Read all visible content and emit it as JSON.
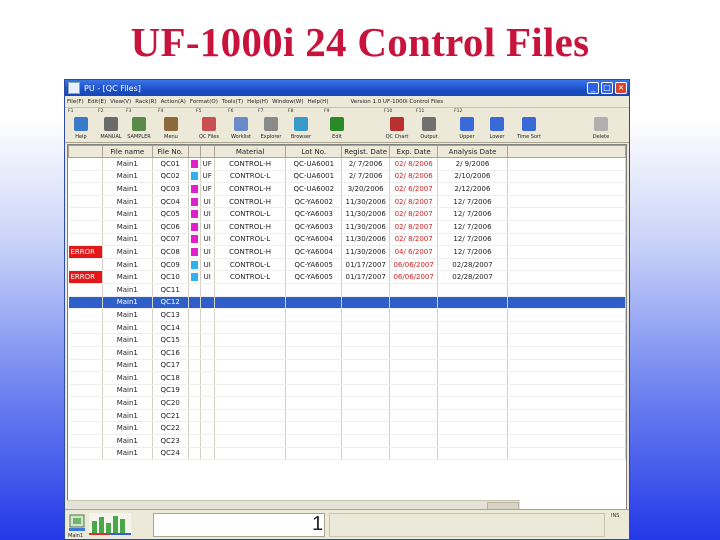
{
  "slide": {
    "title": "UF-1000i 24 Control Files",
    "page_number": "1"
  },
  "window": {
    "title": "PU - [QC Files]"
  },
  "menu": {
    "items": [
      "File(F)",
      "Edit(E)",
      "View(V)",
      "Rack(R)",
      "Action(A)",
      "Format(O)",
      "Tools(T)",
      "Help(H)",
      "Window(W)",
      "Help(H)"
    ],
    "right_text": "Version 1.0 UF-1000i Control Files"
  },
  "toolbar": {
    "buttons": [
      {
        "key": "F1",
        "label": "Help",
        "icon_color": "#3a78c8"
      },
      {
        "key": "F2",
        "label": "MANUAL",
        "icon_color": "#6a6a6a"
      },
      {
        "key": "F3",
        "label": "SAMPLER",
        "icon_color": "#5a8a4a"
      },
      {
        "key": "F4",
        "label": "Menu",
        "icon_color": "#8a6a3a"
      },
      {
        "key": "F5",
        "label": "QC Files",
        "icon_color": "#c85050"
      },
      {
        "key": "F6",
        "label": "Worklist",
        "icon_color": "#6a8ac8"
      },
      {
        "key": "F7",
        "label": "Explorer",
        "icon_color": "#8a8a8a"
      },
      {
        "key": "F8",
        "label": "Browser",
        "icon_color": "#3a9ac8"
      },
      {
        "key": "F9",
        "label": "Edit",
        "icon_color": "#2a8a2a"
      },
      {
        "key": "F10",
        "label": "QC Chart",
        "icon_color": "#b83030"
      },
      {
        "key": "F11",
        "label": "Output",
        "icon_color": "#707070"
      },
      {
        "key": "F12",
        "label": "Upper",
        "icon_color": "#3a6ad8"
      },
      {
        "key": "",
        "label": "Lower",
        "icon_color": "#3a6ad8"
      },
      {
        "key": "",
        "label": "Time Sort",
        "icon_color": "#3a6ad8"
      },
      {
        "key": "",
        "label": "Delete",
        "icon_color": "#b0b0b0"
      }
    ]
  },
  "grid": {
    "headers": [
      "",
      "File name",
      "File No.",
      "",
      "Material",
      "Lot No.",
      "Regist. Date",
      "Exp. Date",
      "Analysis Date"
    ],
    "rows": [
      {
        "status": "",
        "name": "Main1",
        "no": "QC01",
        "color": "#e020c8",
        "type": "UF",
        "material": "CONTROL-H",
        "lot": "QC-UA6001",
        "reg": "2/ 7/2006",
        "exp": "02/ 8/2006",
        "ana": "2/ 9/2006"
      },
      {
        "status": "",
        "name": "Main1",
        "no": "QC02",
        "color": "#30b0f0",
        "type": "UF",
        "material": "CONTROL-L",
        "lot": "QC-UA6001",
        "reg": "2/ 7/2006",
        "exp": "02/ 8/2006",
        "ana": "2/10/2006"
      },
      {
        "status": "",
        "name": "Main1",
        "no": "QC03",
        "color": "#e020c8",
        "type": "UF",
        "material": "CONTROL-H",
        "lot": "QC-UA6002",
        "reg": "3/20/2006",
        "exp": "02/ 6/2007",
        "ana": "2/12/2006"
      },
      {
        "status": "",
        "name": "Main1",
        "no": "QC04",
        "color": "#e020c8",
        "type": "UI",
        "material": "CONTROL-H",
        "lot": "QC-YA6002",
        "reg": "11/30/2006",
        "exp": "02/ 8/2007",
        "ana": "12/ 7/2006"
      },
      {
        "status": "",
        "name": "Main1",
        "no": "QC05",
        "color": "#e020c8",
        "type": "UI",
        "material": "CONTROL-L",
        "lot": "QC-YA6003",
        "reg": "11/30/2006",
        "exp": "02/ 8/2007",
        "ana": "12/ 7/2006"
      },
      {
        "status": "",
        "name": "Main1",
        "no": "QC06",
        "color": "#e020c8",
        "type": "UI",
        "material": "CONTROL-H",
        "lot": "QC-YA6003",
        "reg": "11/30/2006",
        "exp": "02/ 8/2007",
        "ana": "12/ 7/2006"
      },
      {
        "status": "",
        "name": "Main1",
        "no": "QC07",
        "color": "#e020c8",
        "type": "UI",
        "material": "CONTROL-L",
        "lot": "QC-YA6004",
        "reg": "11/30/2006",
        "exp": "02/ 8/2007",
        "ana": "12/ 7/2006"
      },
      {
        "status": "ERROR",
        "name": "Main1",
        "no": "QC08",
        "color": "#e020c8",
        "type": "UI",
        "material": "CONTROL-H",
        "lot": "QC-YA6004",
        "reg": "11/30/2006",
        "exp": "04/ 6/2007",
        "ana": "12/ 7/2006"
      },
      {
        "status": "",
        "name": "Main1",
        "no": "QC09",
        "color": "#30b0f0",
        "type": "UI",
        "material": "CONTROL-L",
        "lot": "QC-YA6005",
        "reg": "01/17/2007",
        "exp": "06/06/2007",
        "ana": "02/28/2007"
      },
      {
        "status": "ERROR",
        "name": "Main1",
        "no": "QC10",
        "color": "#30b0f0",
        "type": "UI",
        "material": "CONTROL-L",
        "lot": "QC-YA6005",
        "reg": "01/17/2007",
        "exp": "06/06/2007",
        "ana": "02/28/2007"
      },
      {
        "status": "",
        "name": "Main1",
        "no": "QC11",
        "color": "",
        "type": "",
        "material": "",
        "lot": "",
        "reg": "",
        "exp": "",
        "ana": ""
      },
      {
        "status": "",
        "name": "Main1",
        "no": "QC12",
        "color": "",
        "type": "",
        "material": "",
        "lot": "",
        "reg": "",
        "exp": "",
        "ana": "",
        "selected": true
      },
      {
        "status": "",
        "name": "Main1",
        "no": "QC13",
        "color": "",
        "type": "",
        "material": "",
        "lot": "",
        "reg": "",
        "exp": "",
        "ana": ""
      },
      {
        "status": "",
        "name": "Main1",
        "no": "QC14",
        "color": "",
        "type": "",
        "material": "",
        "lot": "",
        "reg": "",
        "exp": "",
        "ana": ""
      },
      {
        "status": "",
        "name": "Main1",
        "no": "QC15",
        "color": "",
        "type": "",
        "material": "",
        "lot": "",
        "reg": "",
        "exp": "",
        "ana": ""
      },
      {
        "status": "",
        "name": "Main1",
        "no": "QC16",
        "color": "",
        "type": "",
        "material": "",
        "lot": "",
        "reg": "",
        "exp": "",
        "ana": ""
      },
      {
        "status": "",
        "name": "Main1",
        "no": "QC17",
        "color": "",
        "type": "",
        "material": "",
        "lot": "",
        "reg": "",
        "exp": "",
        "ana": ""
      },
      {
        "status": "",
        "name": "Main1",
        "no": "QC18",
        "color": "",
        "type": "",
        "material": "",
        "lot": "",
        "reg": "",
        "exp": "",
        "ana": ""
      },
      {
        "status": "",
        "name": "Main1",
        "no": "QC19",
        "color": "",
        "type": "",
        "material": "",
        "lot": "",
        "reg": "",
        "exp": "",
        "ana": ""
      },
      {
        "status": "",
        "name": "Main1",
        "no": "QC20",
        "color": "",
        "type": "",
        "material": "",
        "lot": "",
        "reg": "",
        "exp": "",
        "ana": ""
      },
      {
        "status": "",
        "name": "Main1",
        "no": "QC21",
        "color": "",
        "type": "",
        "material": "",
        "lot": "",
        "reg": "",
        "exp": "",
        "ana": ""
      },
      {
        "status": "",
        "name": "Main1",
        "no": "QC22",
        "color": "",
        "type": "",
        "material": "",
        "lot": "",
        "reg": "",
        "exp": "",
        "ana": ""
      },
      {
        "status": "",
        "name": "Main1",
        "no": "QC23",
        "color": "",
        "type": "",
        "material": "",
        "lot": "",
        "reg": "",
        "exp": "",
        "ana": ""
      },
      {
        "status": "",
        "name": "Main1",
        "no": "QC24",
        "color": "",
        "type": "",
        "material": "",
        "lot": "",
        "reg": "",
        "exp": "",
        "ana": ""
      }
    ]
  },
  "statusbar": {
    "icon_label": "Main1",
    "corner_text": "INS"
  },
  "colors": {
    "accent": "#c8143c",
    "error": "#e41818",
    "selection": "#2e5ec8"
  }
}
